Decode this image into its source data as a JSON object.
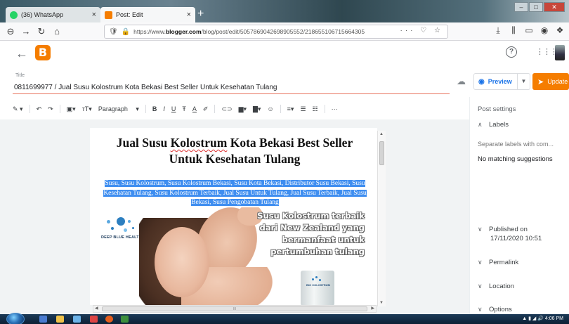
{
  "browser": {
    "tabs": [
      {
        "label": "(36) WhatsApp",
        "icon": "whatsapp-icon",
        "color": "#25d366"
      },
      {
        "label": "Post: Edit",
        "icon": "blogger-icon",
        "color": "#f57d00"
      }
    ],
    "url_prefix": "https://www.",
    "url_domain": "blogger.com",
    "url_path": "/blog/post/edit/5057869042698905552/218655106715664305"
  },
  "blogger": {
    "logo": "B",
    "accent": "#f57d00"
  },
  "post": {
    "title_label": "Title",
    "title_value": "0811699977 / Jual Susu Kolostrum Kota Bekasi Best Seller Untuk Kesehatan Tulang",
    "preview_label": "Preview",
    "update_label": "Update"
  },
  "toolbar": {
    "paragraph_label": "Paragraph",
    "bold": "B",
    "italic": "I",
    "underline": "U",
    "strike": "T̶",
    "more": "···"
  },
  "content": {
    "heading_line1_a": "Jual Susu ",
    "heading_line1_b": "Kolostrum",
    "heading_line1_c": " Kota Bekasi Best Seller",
    "heading_line2": "Untuk Kesehatan Tulang",
    "keywords": "Susu, Susu Kolostrum, Susu Kolostrum Bekasi, Susu Kota Bekasi, Distributor Susu Bekasi, Susu Kesehatan Tulang, Susu Kolostrum Terbaik, Jual Susu Untuk Tulang, Jual Susu Terbaik, Jual Susu Bekasi, Susu Pengobatan Tulang",
    "brand": "DEEP BLUE HEALTH",
    "promo_line1": "Susu Kolostrum terbaik",
    "promo_line2": "dari New Zealand yang",
    "promo_line3": "bermanfaat untuk",
    "promo_line4": "pertumbuhan tulang",
    "product_label": "BIO COLOSTRUM"
  },
  "sidebar": {
    "post_settings": "Post settings",
    "labels": "Labels",
    "labels_placeholder": "Separate labels with com...",
    "no_matching": "No matching suggestions",
    "published_on": "Published on",
    "published_date": "17/11/2020 10:51",
    "permalink": "Permalink",
    "location": "Location",
    "options": "Options"
  },
  "taskbar": {
    "time": "4:06 PM"
  }
}
